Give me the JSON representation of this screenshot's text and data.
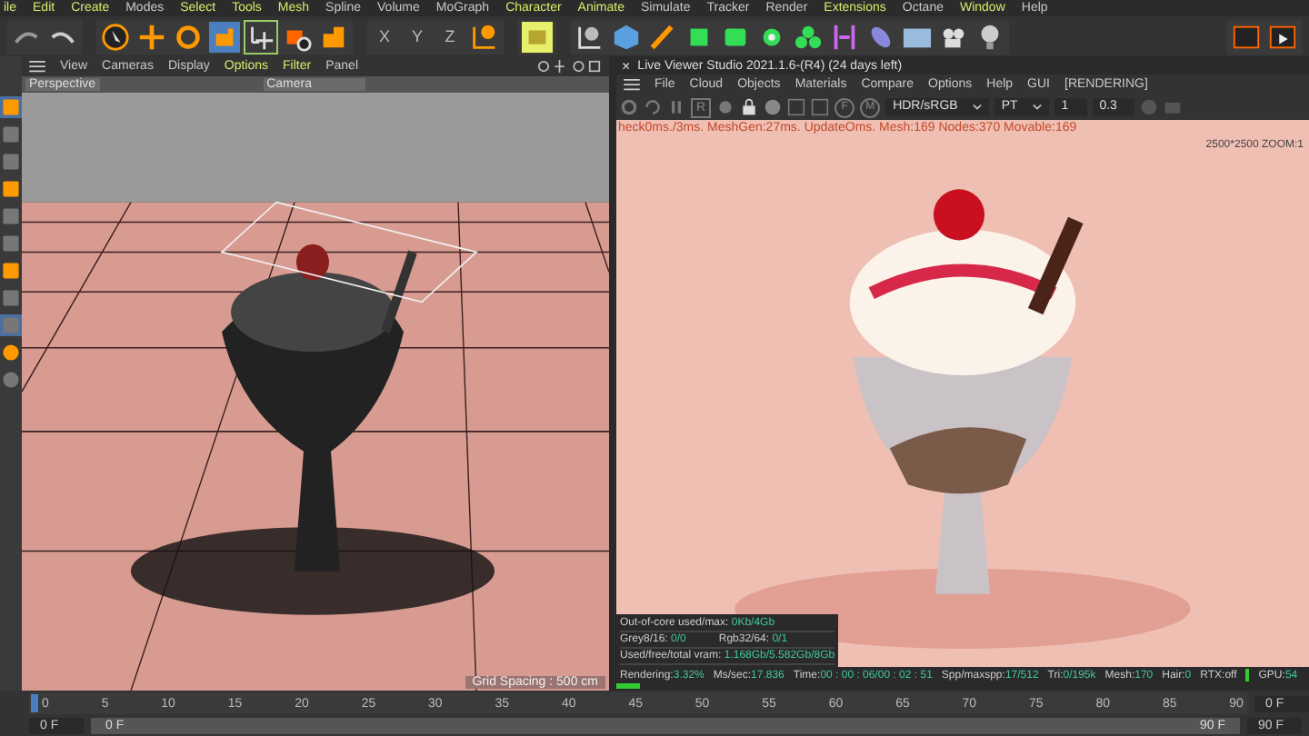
{
  "menu_bar": [
    {
      "label": "ile",
      "highlighted": true
    },
    {
      "label": "Edit",
      "highlighted": true
    },
    {
      "label": "Create",
      "highlighted": true
    },
    {
      "label": "Modes",
      "highlighted": false
    },
    {
      "label": "Select",
      "highlighted": true
    },
    {
      "label": "Tools",
      "highlighted": true
    },
    {
      "label": "Mesh",
      "highlighted": true
    },
    {
      "label": "Spline",
      "highlighted": false
    },
    {
      "label": "Volume",
      "highlighted": false
    },
    {
      "label": "MoGraph",
      "highlighted": false
    },
    {
      "label": "Character",
      "highlighted": true
    },
    {
      "label": "Animate",
      "highlighted": true
    },
    {
      "label": "Simulate",
      "highlighted": false
    },
    {
      "label": "Tracker",
      "highlighted": false
    },
    {
      "label": "Render",
      "highlighted": false
    },
    {
      "label": "Extensions",
      "highlighted": true
    },
    {
      "label": "Octane",
      "highlighted": false
    },
    {
      "label": "Window",
      "highlighted": true
    },
    {
      "label": "Help",
      "highlighted": false
    }
  ],
  "axis_locks": [
    "X",
    "Y",
    "Z"
  ],
  "viewport": {
    "menu": [
      {
        "label": "View",
        "highlighted": false
      },
      {
        "label": "Cameras",
        "highlighted": false
      },
      {
        "label": "Display",
        "highlighted": false
      },
      {
        "label": "Options",
        "highlighted": true
      },
      {
        "label": "Filter",
        "highlighted": true
      },
      {
        "label": "Panel",
        "highlighted": false
      }
    ],
    "view_name": "Perspective",
    "camera": "Camera",
    "grid_spacing": "Grid Spacing : 500 cm"
  },
  "live_viewer": {
    "close": "×",
    "title": "Live Viewer Studio 2021.1.6-(R4) (24 days left)",
    "menu": [
      "File",
      "Cloud",
      "Objects",
      "Materials",
      "Compare",
      "Options",
      "Help",
      "GUI",
      "[RENDERING]"
    ],
    "toolbar_letters": [
      "R",
      "F",
      "M"
    ],
    "color_space": "HDR/sRGB",
    "kernel": "PT",
    "value_1": "1",
    "value_2": "0.3",
    "info_line": "heck0ms./3ms. MeshGen:27ms. UpdateOms. Mesh:169 Nodes:370 Movable:169",
    "resolution": "2500*2500 ZOOM:1",
    "memory": [
      {
        "label": "Out-of-core used/max:",
        "value": "0Kb/4Gb"
      },
      {
        "label": "Grey8/16:",
        "value": "0/0",
        "label_2": "Rgb32/64:",
        "value_2": "0/1"
      },
      {
        "label": "Used/free/total vram:",
        "value": "1.168Gb/5.582Gb/8Gb"
      }
    ],
    "status": [
      {
        "label": "Rendering:",
        "value": "3.32%"
      },
      {
        "label": "Ms/sec:",
        "value": "17.836"
      },
      {
        "label": "Time:",
        "value": "00 : 00 : 06/00 : 02 : 51"
      },
      {
        "label": "Spp/maxspp:",
        "value": "17/512"
      },
      {
        "label": "Tri:",
        "value": "0/195k"
      },
      {
        "label": "Mesh:",
        "value": "170"
      },
      {
        "label": "Hair:",
        "value": "0"
      },
      {
        "label": "RTX:off"
      },
      {
        "label": "GPU:",
        "value": "54"
      }
    ],
    "progress": {
      "level": 0.0332
    }
  },
  "timeline": {
    "ticks": [
      "0",
      "5",
      "10",
      "15",
      "20",
      "25",
      "30",
      "35",
      "40",
      "45",
      "50",
      "55",
      "60",
      "65",
      "70",
      "75",
      "80",
      "85",
      "90"
    ],
    "current_frame": "0 F",
    "start": "0 F",
    "range_start": "0 F",
    "range_end": "90 F",
    "end": "90 F"
  }
}
